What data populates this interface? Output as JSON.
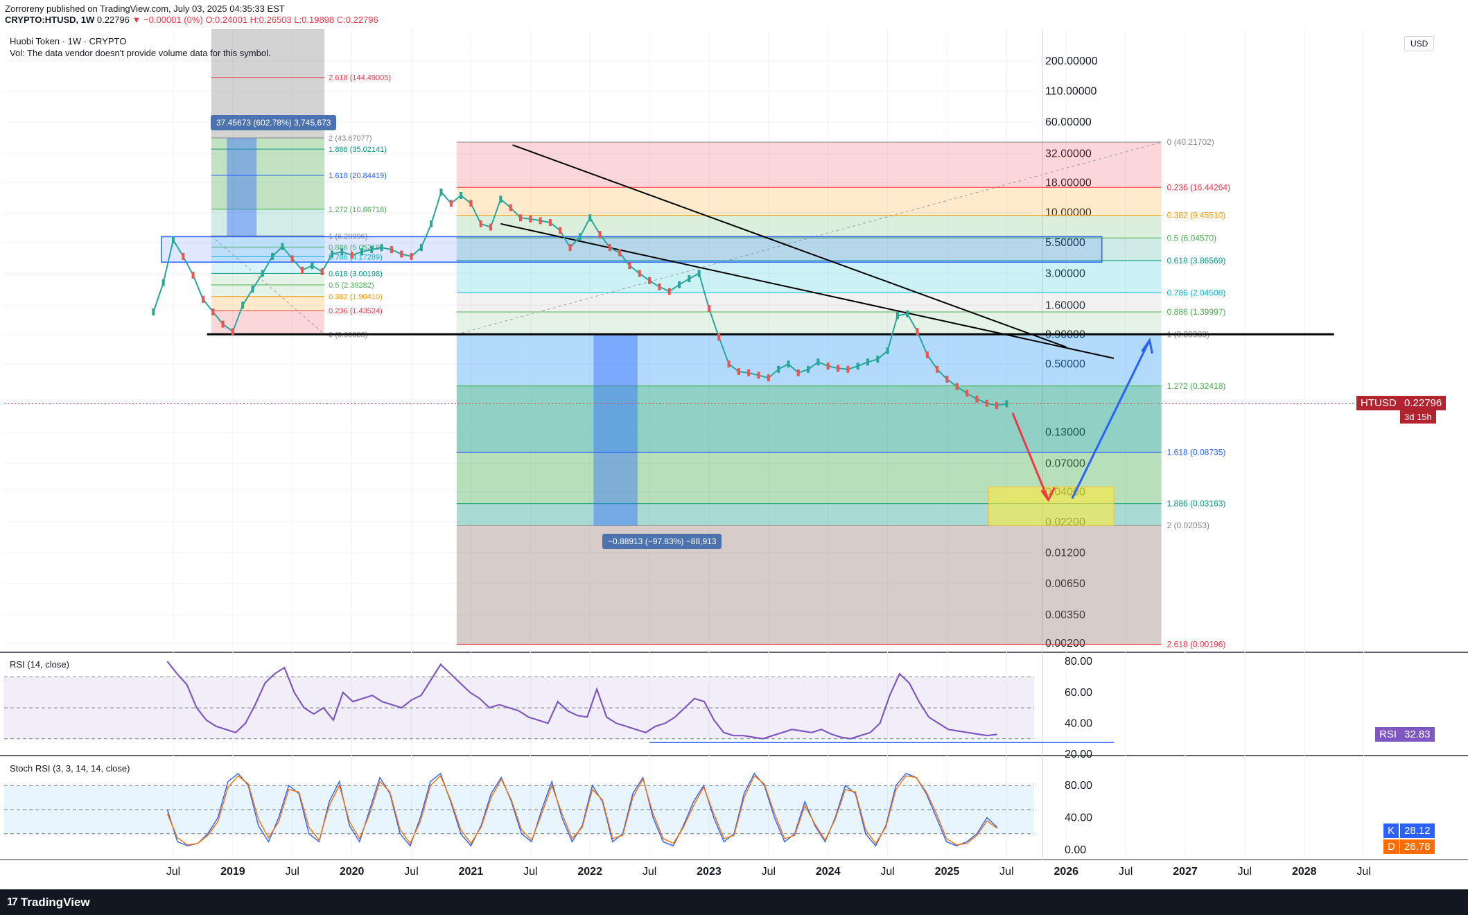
{
  "header": {
    "published_line": "Zorroreny published on TradingView.com, July 03, 2025 04:35:33 EST",
    "symbol": "CRYPTO:HTUSD, 1W",
    "last": "0.22796",
    "arrow": "▼",
    "change": "−0.00001 (0%)",
    "open": "O:0.24001",
    "high": "H:0.26503",
    "low": "L:0.19898",
    "close": "C:0.22796"
  },
  "legend": {
    "title": "Huobi Token · 1W · CRYPTO",
    "volume_note": "Vol: The data vendor doesn't provide volume data for this symbol."
  },
  "currency_button": "USD",
  "price_axis": {
    "ticks": [
      "200.00000",
      "110.00000",
      "60.00000",
      "32.00000",
      "18.00000",
      "10.00000",
      "5.50000",
      "3.00000",
      "1.60000",
      "0.90000",
      "0.50000",
      "0.13000",
      "0.07000",
      "0.04000",
      "0.02200",
      "0.01200",
      "0.00650",
      "0.00350",
      "0.00200"
    ],
    "last_price_tag": {
      "symbol": "HTUSD",
      "value": "0.22796",
      "countdown": "3d 15h",
      "color": "#b2232f"
    }
  },
  "time_axis": {
    "ticks": [
      "Jul",
      "2019",
      "Jul",
      "2020",
      "Jul",
      "2021",
      "Jul",
      "2022",
      "Jul",
      "2023",
      "Jul",
      "2024",
      "Jul",
      "2025",
      "Jul",
      "2026",
      "Jul",
      "2027",
      "Jul",
      "2028",
      "Jul"
    ]
  },
  "chart_data": [
    {
      "type": "line",
      "title": "",
      "xlabel": "",
      "ylabel": "",
      "y_scale": "log",
      "currency": "USD",
      "ylim": [
        0.002,
        200
      ],
      "xlim": [
        "2018-04",
        "2028-08"
      ],
      "series": [
        {
          "x": [
            "2018-05",
            "2018-06",
            "2018-07",
            "2018-08",
            "2018-09",
            "2018-10",
            "2018-11",
            "2018-12",
            "2019-01",
            "2019-02",
            "2019-03",
            "2019-04",
            "2019-05",
            "2019-06",
            "2019-07",
            "2019-08",
            "2019-09",
            "2019-10",
            "2019-11",
            "2019-12",
            "2020-01",
            "2020-02",
            "2020-03",
            "2020-04",
            "2020-05",
            "2020-06",
            "2020-07",
            "2020-08",
            "2020-09",
            "2020-10",
            "2020-11",
            "2020-12",
            "2021-01",
            "2021-02",
            "2021-03",
            "2021-04",
            "2021-05",
            "2021-06",
            "2021-07",
            "2021-08",
            "2021-09",
            "2021-10",
            "2021-11",
            "2021-12",
            "2022-01",
            "2022-02",
            "2022-03",
            "2022-04",
            "2022-05",
            "2022-06",
            "2022-07",
            "2022-08",
            "2022-09",
            "2022-10",
            "2022-11",
            "2022-12",
            "2023-01",
            "2023-02",
            "2023-03",
            "2023-04",
            "2023-05",
            "2023-06",
            "2023-07",
            "2023-08",
            "2023-09",
            "2023-10",
            "2023-11",
            "2023-12",
            "2024-01",
            "2024-02",
            "2024-03",
            "2024-04",
            "2024-05",
            "2024-06",
            "2024-07",
            "2024-08",
            "2024-09",
            "2024-10",
            "2024-11",
            "2024-12",
            "2025-01",
            "2025-02",
            "2025-03",
            "2025-04",
            "2025-05",
            "2025-06",
            "2025-07"
          ],
          "y": [
            1.4,
            2.5,
            5.8,
            4.2,
            2.9,
            1.8,
            1.4,
            1.1,
            0.95,
            1.6,
            2.2,
            3.0,
            4.2,
            5.1,
            4.0,
            3.2,
            3.5,
            3.1,
            4.4,
            4.6,
            4.3,
            4.6,
            4.8,
            5.0,
            4.8,
            4.4,
            4.2,
            5.0,
            8.0,
            15.0,
            12.0,
            14.0,
            12.0,
            8.0,
            7.5,
            13.0,
            11.0,
            9.0,
            8.8,
            8.5,
            8.2,
            7.0,
            5.0,
            6.2,
            9.0,
            6.5,
            5.0,
            4.5,
            3.5,
            3.0,
            2.6,
            2.3,
            2.1,
            2.4,
            2.7,
            3.0,
            1.5,
            0.85,
            0.5,
            0.43,
            0.42,
            0.4,
            0.38,
            0.45,
            0.5,
            0.42,
            0.45,
            0.52,
            0.48,
            0.46,
            0.45,
            0.48,
            0.52,
            0.55,
            0.65,
            1.3,
            1.35,
            0.95,
            0.6,
            0.45,
            0.37,
            0.32,
            0.28,
            0.25,
            0.23,
            0.22,
            0.228
          ]
        }
      ],
      "fib_retracement_levels": [
        {
          "label": "0 (40.21702)",
          "color": "#888888"
        },
        {
          "label": "0.236 (16.44264)",
          "color": "#f23645"
        },
        {
          "label": "0.382 (9.45510)",
          "color": "#ff9800"
        },
        {
          "label": "0.5 (6.04570)",
          "color": "#4caf50"
        },
        {
          "label": "0.618 (3.86569)",
          "color": "#089981"
        },
        {
          "label": "0.786 (2.04508)",
          "color": "#00bcd4"
        },
        {
          "label": "0.886 (1.39997)",
          "color": "#4caf50"
        },
        {
          "label": "1 (0.89983)",
          "color": "#888888"
        },
        {
          "label": "1.272 (0.32418)",
          "color": "#4caf50"
        },
        {
          "label": "1.618 (0.08735)",
          "color": "#2962ff"
        },
        {
          "label": "1.886 (0.03163)",
          "color": "#089981"
        },
        {
          "label": "2 (0.02053)",
          "color": "#888888"
        },
        {
          "label": "2.618 (0.00196)",
          "color": "#f23645"
        }
      ],
      "fib_left_levels": [
        {
          "label": "2.618 (144.49005)",
          "color": "#f23645"
        },
        {
          "label": "2 (43.67077)",
          "color": "#888888"
        },
        {
          "label": "1.886 (35.02141)",
          "color": "#089981"
        },
        {
          "label": "1.618 (20.84419)",
          "color": "#2962ff"
        },
        {
          "label": "1.272 (10.66718)",
          "color": "#4caf50"
        },
        {
          "label": "1 (6.29996)",
          "color": "#888888"
        },
        {
          "label": "0.886 (5.05219)",
          "color": "#4caf50"
        },
        {
          "label": "0.786 (4.17289)",
          "color": "#00bcd4"
        },
        {
          "label": "0.618 (3.00198)",
          "color": "#089981"
        },
        {
          "label": "0.5 (2.39282)",
          "color": "#4caf50"
        },
        {
          "label": "0.382 (1.90410)",
          "color": "#ff9800"
        },
        {
          "label": "0.236 (1.43524)",
          "color": "#f23645"
        },
        {
          "label": "0 (0.90083)",
          "color": "#888888"
        }
      ],
      "measure_annotations": [
        {
          "label": "37.45673 (602.78%) 3,745,673"
        },
        {
          "label": "−0.88913 (−97.83%) −88,913"
        }
      ]
    },
    {
      "type": "line",
      "title": "RSI (14, close)",
      "ylim": [
        20,
        85
      ],
      "ticks": [
        "80.00",
        "60.00",
        "40.00",
        "20.00"
      ],
      "bands": [
        30,
        70
      ],
      "last_value": "32.83",
      "color": "#7e57c2",
      "series": [
        {
          "name": "RSI",
          "y": [
            80,
            72,
            65,
            50,
            42,
            38,
            36,
            34,
            40,
            52,
            66,
            72,
            76,
            60,
            50,
            46,
            50,
            42,
            60,
            54,
            56,
            58,
            54,
            52,
            50,
            55,
            58,
            68,
            78,
            72,
            66,
            60,
            56,
            50,
            52,
            50,
            48,
            44,
            42,
            40,
            54,
            48,
            45,
            44,
            62,
            44,
            40,
            38,
            36,
            34,
            38,
            40,
            44,
            50,
            56,
            54,
            42,
            34,
            32,
            32,
            31,
            30,
            32,
            34,
            36,
            35,
            34,
            36,
            33,
            31,
            30,
            32,
            34,
            40,
            58,
            72,
            66,
            54,
            44,
            40,
            36,
            35,
            34,
            33,
            32,
            32.83
          ]
        }
      ]
    },
    {
      "type": "line",
      "title": "Stoch RSI (3, 3, 14, 14, close)",
      "ylim": [
        0,
        100
      ],
      "ticks": [
        "80.00",
        "40.00",
        "0.00"
      ],
      "bands": [
        20,
        80
      ],
      "series": [
        {
          "name": "K",
          "last_value": "28.12",
          "color": "#2962ff",
          "y": [
            50,
            10,
            5,
            8,
            20,
            40,
            85,
            95,
            80,
            30,
            10,
            40,
            80,
            70,
            20,
            10,
            60,
            85,
            30,
            10,
            50,
            90,
            70,
            20,
            5,
            40,
            85,
            95,
            60,
            20,
            5,
            30,
            70,
            90,
            60,
            20,
            10,
            50,
            85,
            40,
            10,
            30,
            80,
            60,
            10,
            20,
            70,
            90,
            40,
            10,
            5,
            30,
            60,
            80,
            40,
            10,
            20,
            70,
            95,
            80,
            40,
            10,
            20,
            60,
            30,
            10,
            40,
            80,
            70,
            20,
            5,
            30,
            80,
            95,
            90,
            70,
            40,
            10,
            5,
            10,
            20,
            40,
            28.12
          ]
        },
        {
          "name": "D",
          "last_value": "26.78",
          "color": "#ff6d00",
          "y": [
            45,
            15,
            6,
            8,
            18,
            35,
            78,
            92,
            82,
            38,
            15,
            35,
            75,
            72,
            28,
            12,
            55,
            80,
            35,
            14,
            45,
            85,
            72,
            25,
            8,
            35,
            80,
            92,
            62,
            25,
            8,
            28,
            65,
            88,
            62,
            25,
            12,
            45,
            80,
            45,
            14,
            28,
            75,
            62,
            14,
            18,
            65,
            88,
            45,
            14,
            8,
            28,
            55,
            78,
            45,
            14,
            18,
            65,
            92,
            82,
            45,
            14,
            18,
            55,
            32,
            12,
            38,
            75,
            72,
            25,
            8,
            28,
            75,
            92,
            90,
            72,
            45,
            14,
            6,
            8,
            18,
            36,
            26.78
          ]
        }
      ]
    }
  ]
}
